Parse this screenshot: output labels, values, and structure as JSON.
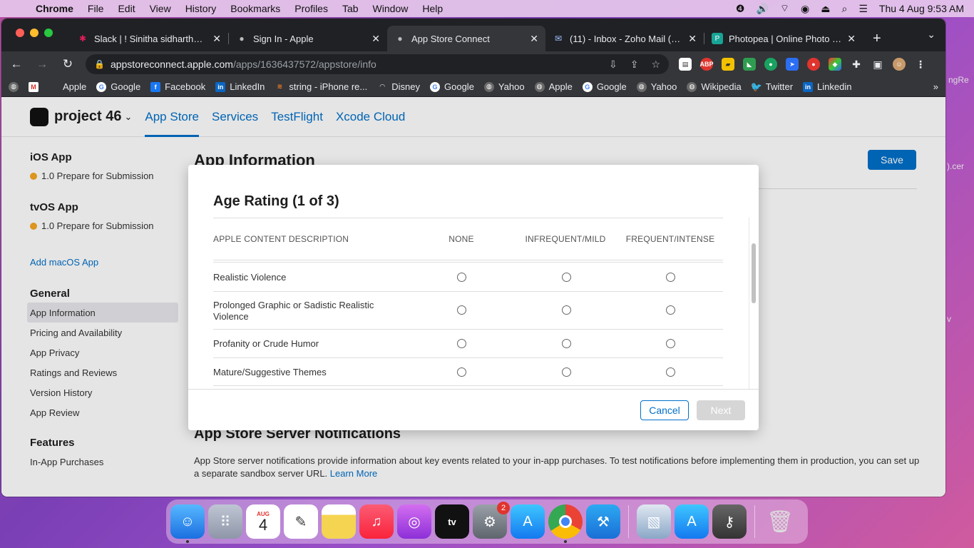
{
  "menubar": {
    "app": "Chrome",
    "items": [
      "File",
      "Edit",
      "View",
      "History",
      "Bookmarks",
      "Profiles",
      "Tab",
      "Window",
      "Help"
    ],
    "clock": "Thu 4 Aug  9:53 AM"
  },
  "browser": {
    "tabs": [
      {
        "title": "Slack | ! Sinitha sidharthan |",
        "icon": "slack-icon"
      },
      {
        "title": "Sign In - Apple",
        "icon": "apple-icon"
      },
      {
        "title": "App Store Connect",
        "icon": "apple-icon",
        "active": true
      },
      {
        "title": "(11) - Inbox - Zoho Mail (affi",
        "icon": "mail-icon"
      },
      {
        "title": "Photopea | Online Photo Edi",
        "icon": "photopea-icon"
      }
    ],
    "url_host": "appstoreconnect.apple.com",
    "url_path": "/apps/1636437572/appstore/info",
    "bookmarks": [
      "Apple",
      "Google",
      "Facebook",
      "LinkedIn",
      "string - iPhone re...",
      "Disney",
      "Google",
      "Yahoo",
      "Apple",
      "Google",
      "Yahoo",
      "Wikipedia",
      "Twitter",
      "Linkedin"
    ]
  },
  "app_header": {
    "app_name": "project 46",
    "nav": [
      "App Store",
      "Services",
      "TestFlight",
      "Xcode Cloud"
    ]
  },
  "sidebar": {
    "ios_heading": "iOS App",
    "ios_status": "1.0 Prepare for Submission",
    "tvos_heading": "tvOS App",
    "tvos_status": "1.0 Prepare for Submission",
    "add_macos": "Add macOS App",
    "general_heading": "General",
    "general_items": [
      "App Information",
      "Pricing and Availability",
      "App Privacy",
      "Ratings and Reviews",
      "Version History",
      "App Review"
    ],
    "features_heading": "Features",
    "features_items": [
      "In-App Purchases"
    ]
  },
  "main": {
    "title": "App Information",
    "save_label": "Save",
    "notif_title": "App Store Server Notifications",
    "notif_text": "App Store server notifications provide information about key events related to your in-app purchases. To test notifications before implementing them in production, you can set up a separate sandbox server URL.",
    "learn_more": "Learn More"
  },
  "modal": {
    "title": "Age Rating (1 of 3)",
    "columns": [
      "APPLE CONTENT DESCRIPTION",
      "NONE",
      "INFREQUENT/MILD",
      "FREQUENT/INTENSE"
    ],
    "rows": [
      "Realistic Violence",
      "Prolonged Graphic or Sadistic Realistic Violence",
      "Profanity or Crude Humor",
      "Mature/Suggestive Themes"
    ],
    "cancel_label": "Cancel",
    "next_label": "Next"
  },
  "dock": {
    "calendar_month": "AUG",
    "calendar_day": "4",
    "settings_badge": "2",
    "tv_label": "tv"
  },
  "peek": {
    "text1": "ngRe",
    "text2": ").cer",
    "text3": "v"
  }
}
